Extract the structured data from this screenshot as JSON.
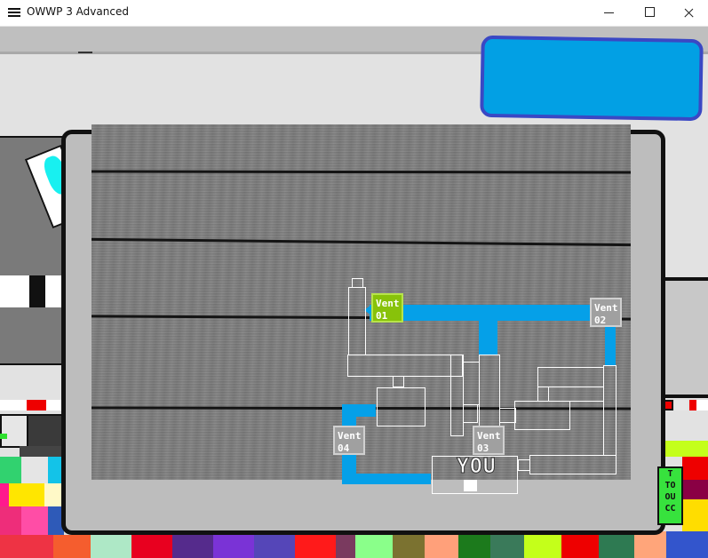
{
  "window": {
    "title": "OWWP 3 Advanced",
    "icon": "hamburger-icon",
    "controls": [
      "minimize-icon",
      "maximize-icon",
      "close-icon"
    ]
  },
  "colors": {
    "status_box": "#02a0e4",
    "status_box_border": "#3a48c4",
    "vent_path": "#05a0e8",
    "vent_active": "#88c20a",
    "vent_idle": "#a0a0a0",
    "map_outline": "#ffffff",
    "monitor_frame": "#bdbdbd"
  },
  "vent_map": {
    "vents": [
      {
        "id": "vent-01",
        "line1": "Vent",
        "line2": "01",
        "active": true
      },
      {
        "id": "vent-02",
        "line1": "Vent",
        "line2": "02",
        "active": false
      },
      {
        "id": "vent-03",
        "line1": "Vent",
        "line2": "03",
        "active": false
      },
      {
        "id": "vent-04",
        "line1": "Vent",
        "line2": "04",
        "active": false
      }
    ],
    "player_label": "YOU"
  },
  "side_sign": {
    "lines": [
      "T",
      "TO",
      "OU",
      "CC"
    ]
  }
}
